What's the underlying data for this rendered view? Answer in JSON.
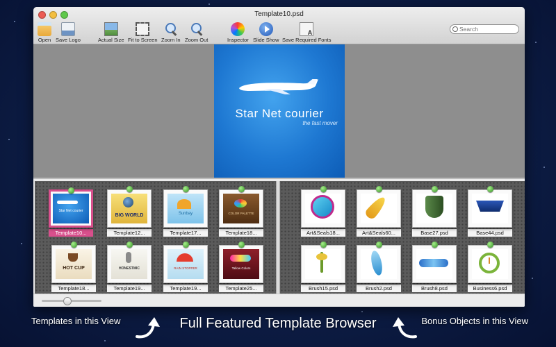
{
  "window": {
    "title": "Template10.psd"
  },
  "toolbar": [
    {
      "label": "Open",
      "icon": "folder-open-icon"
    },
    {
      "label": "Save Logo",
      "icon": "save-logo-icon"
    },
    {
      "label": "Actual Size",
      "icon": "picture-icon"
    },
    {
      "label": "Fit to Screen",
      "icon": "fit-screen-icon"
    },
    {
      "label": "Zoom In",
      "icon": "zoom-in-icon"
    },
    {
      "label": "Zoom Out",
      "icon": "zoom-out-icon"
    },
    {
      "label": "Inspector",
      "icon": "color-wheel-icon"
    },
    {
      "label": "Slide Show",
      "icon": "play-icon"
    },
    {
      "label": "Save Required Fonts",
      "icon": "fonts-icon"
    }
  ],
  "search": {
    "placeholder": "Search",
    "value": ""
  },
  "preview": {
    "title_part1": "Star",
    "title_part2": "Net courier",
    "subtitle": "the fast mover"
  },
  "templates": [
    {
      "label": "Template10...",
      "art": "STAR NET COURIER",
      "selected": true
    },
    {
      "label": "Template12...",
      "art": "BIG WORLD"
    },
    {
      "label": "Template17...",
      "art": "Sunbay"
    },
    {
      "label": "Template18...",
      "art": "COLOR PALETTE"
    },
    {
      "label": "Template18...",
      "art": "HOT CUP"
    },
    {
      "label": "Template19...",
      "art": "HONESTMIC"
    },
    {
      "label": "Template19...",
      "art": "RAIN STOPPER"
    },
    {
      "label": "Template25...",
      "art": "Tallow Colors"
    }
  ],
  "objects": [
    {
      "label": "Art&Seals18..."
    },
    {
      "label": "Art&Seals60..."
    },
    {
      "label": "Base27.psd"
    },
    {
      "label": "Base44.psd"
    },
    {
      "label": "Brush15.psd"
    },
    {
      "label": "Brush2.psd"
    },
    {
      "label": "Brush8.psd"
    },
    {
      "label": "Business6.psd"
    }
  ],
  "zoom_slider": {
    "value_fraction": 0.42
  },
  "captions": {
    "left": "Templates in this View",
    "center": "Full Featured  Template Browser",
    "right": "Bonus Objects in this View"
  },
  "colors": {
    "selection": "#d84f8c",
    "pin": "#2f8f1f",
    "preview_bg": "#1e78d2"
  }
}
